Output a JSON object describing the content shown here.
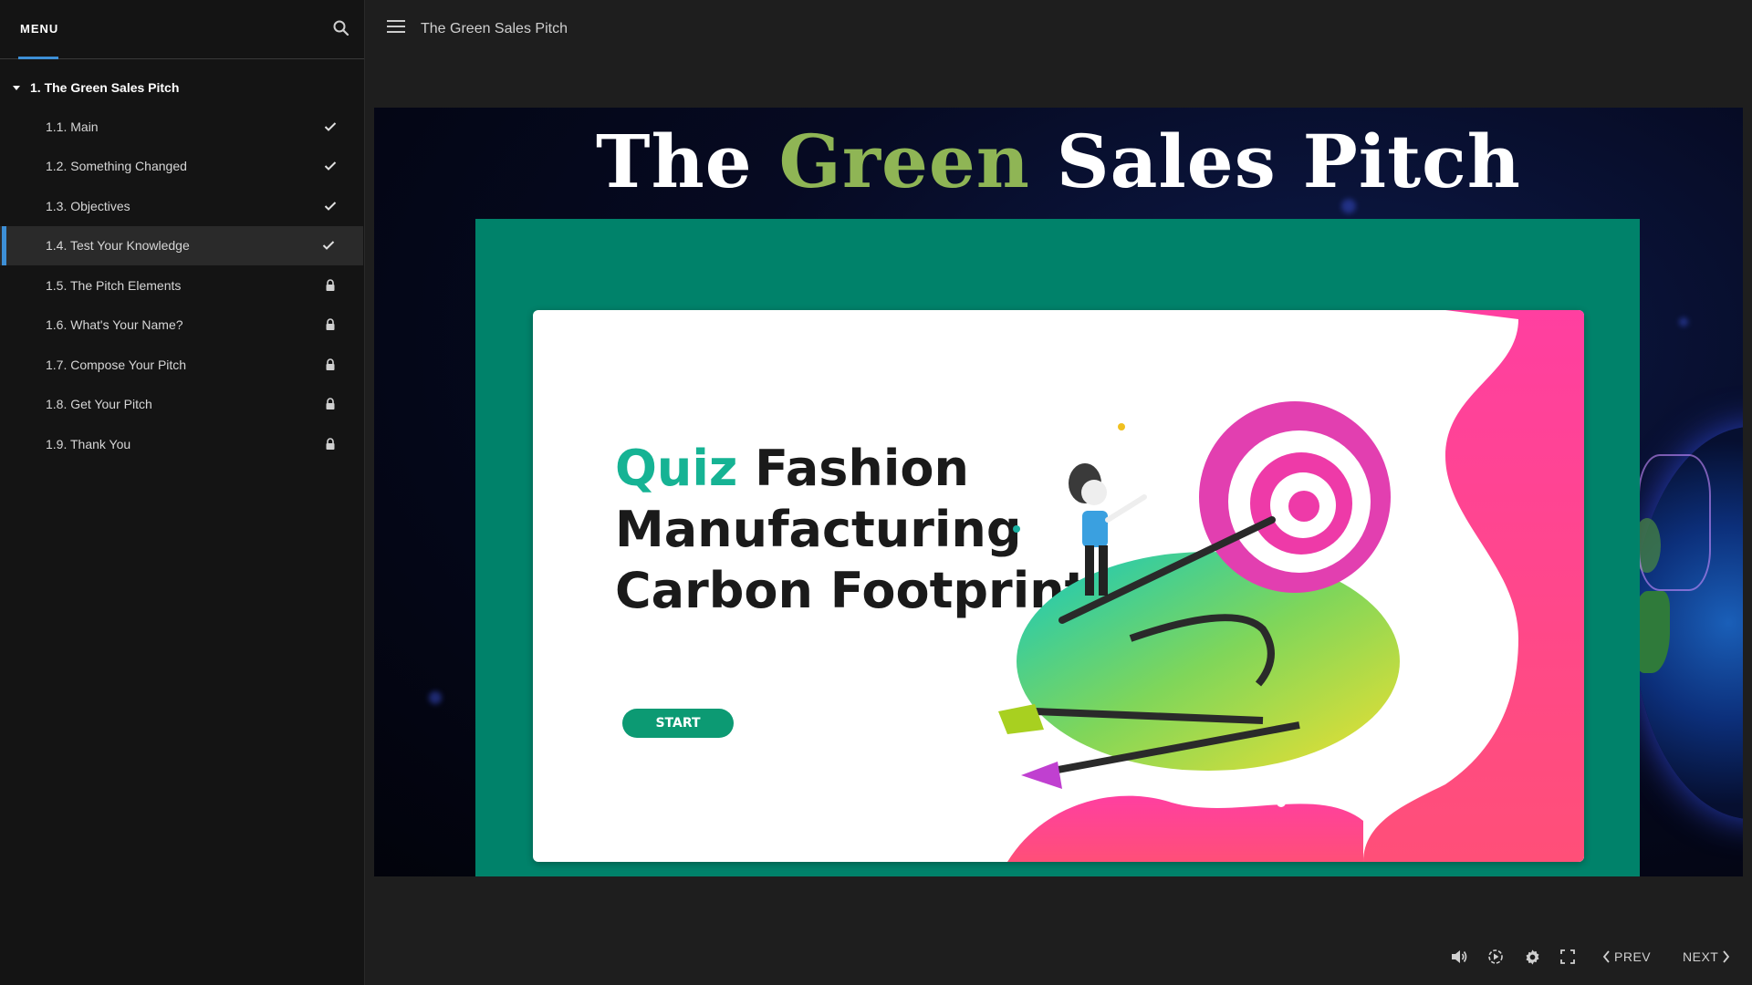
{
  "sidebar": {
    "menu_tab": "MENU",
    "section_title": "1. The Green Sales Pitch",
    "lessons": [
      {
        "label": "1.1. Main",
        "status": "complete"
      },
      {
        "label": "1.2. Something Changed",
        "status": "complete"
      },
      {
        "label": "1.3. Objectives",
        "status": "complete"
      },
      {
        "label": "1.4. Test Your Knowledge",
        "status": "complete",
        "active": true
      },
      {
        "label": "1.5. The Pitch Elements",
        "status": "locked"
      },
      {
        "label": "1.6. What's Your Name?",
        "status": "locked"
      },
      {
        "label": "1.7. Compose Your Pitch",
        "status": "locked"
      },
      {
        "label": "1.8. Get Your Pitch",
        "status": "locked"
      },
      {
        "label": "1.9. Thank You",
        "status": "locked"
      }
    ]
  },
  "topbar": {
    "course_title": "The Green Sales Pitch"
  },
  "slide": {
    "title_part1": "The ",
    "title_green": "Green",
    "title_part2": " Sales Pitch",
    "quiz_word": "Quiz",
    "heading_line1_rest": " Fashion",
    "heading_line2": "Manufacturing",
    "heading_line3": "Carbon Footprint",
    "start_label": "START"
  },
  "controls": {
    "prev_label": "PREV",
    "next_label": "NEXT",
    "icons": [
      "volume-icon",
      "playback-speed-icon",
      "settings-gear-icon",
      "fullscreen-icon"
    ]
  },
  "colors": {
    "accent_blue": "#3d8fd6",
    "title_green": "#8fb555",
    "quiz_frame": "#00826a",
    "quiz_teal": "#16b394",
    "start_button": "#0c9a73"
  }
}
